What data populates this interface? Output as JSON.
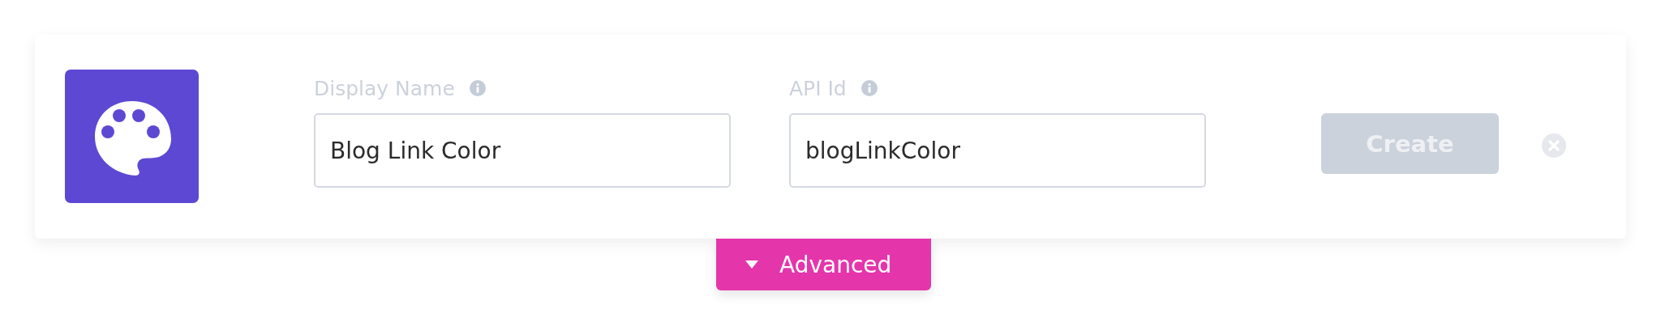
{
  "fields": [
    {
      "label": "Display Name",
      "value": "Blog Link Color"
    },
    {
      "label": "API Id",
      "value": "blogLinkColor"
    }
  ],
  "create_button": {
    "label": "Create",
    "disabled": true
  },
  "advanced_button": {
    "label": "Advanced",
    "expanded": false
  }
}
